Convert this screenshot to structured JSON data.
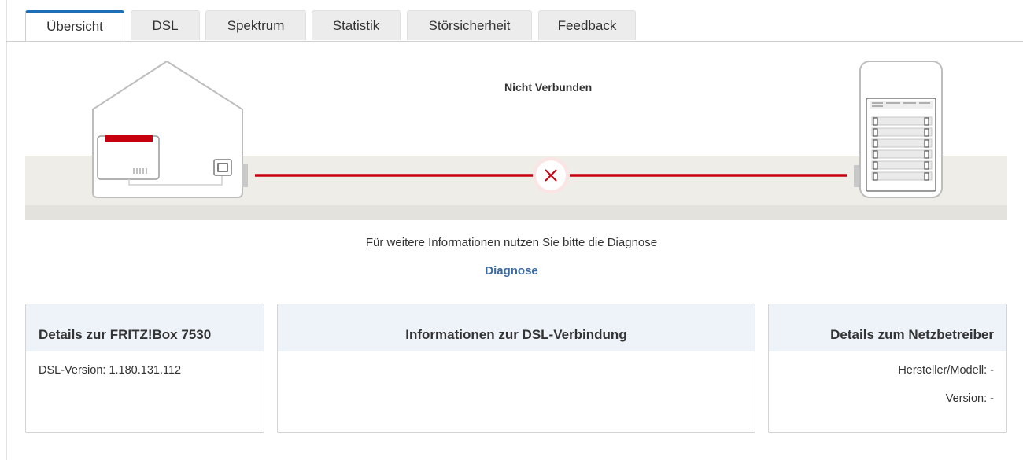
{
  "tabs": [
    {
      "label": "Übersicht",
      "active": true
    },
    {
      "label": "DSL",
      "active": false
    },
    {
      "label": "Spektrum",
      "active": false
    },
    {
      "label": "Statistik",
      "active": false
    },
    {
      "label": "Störsicherheit",
      "active": false
    },
    {
      "label": "Feedback",
      "active": false
    }
  ],
  "connection": {
    "status": "Nicht Verbunden",
    "line_color": "#c6000f",
    "icon": "disconnected-x-icon"
  },
  "info_text": "Für weitere Informationen nutzen Sie bitte die Diagnose",
  "diagnose_link": "Diagnose",
  "panels": {
    "fritzbox": {
      "title": "Details zur FRITZ!Box 7530",
      "dsl_version": "DSL-Version: 1.180.131.112"
    },
    "dsl_connection": {
      "title": "Informationen zur DSL-Verbindung"
    },
    "provider": {
      "title": "Details zum Netzbetreiber",
      "manufacturer": "Hersteller/Modell: -",
      "version": "Version: -"
    }
  },
  "colors": {
    "accent": "#1e6fb5",
    "link": "#3c6aa3",
    "error_red": "#c6000f",
    "panel_header": "#eef3f9"
  }
}
